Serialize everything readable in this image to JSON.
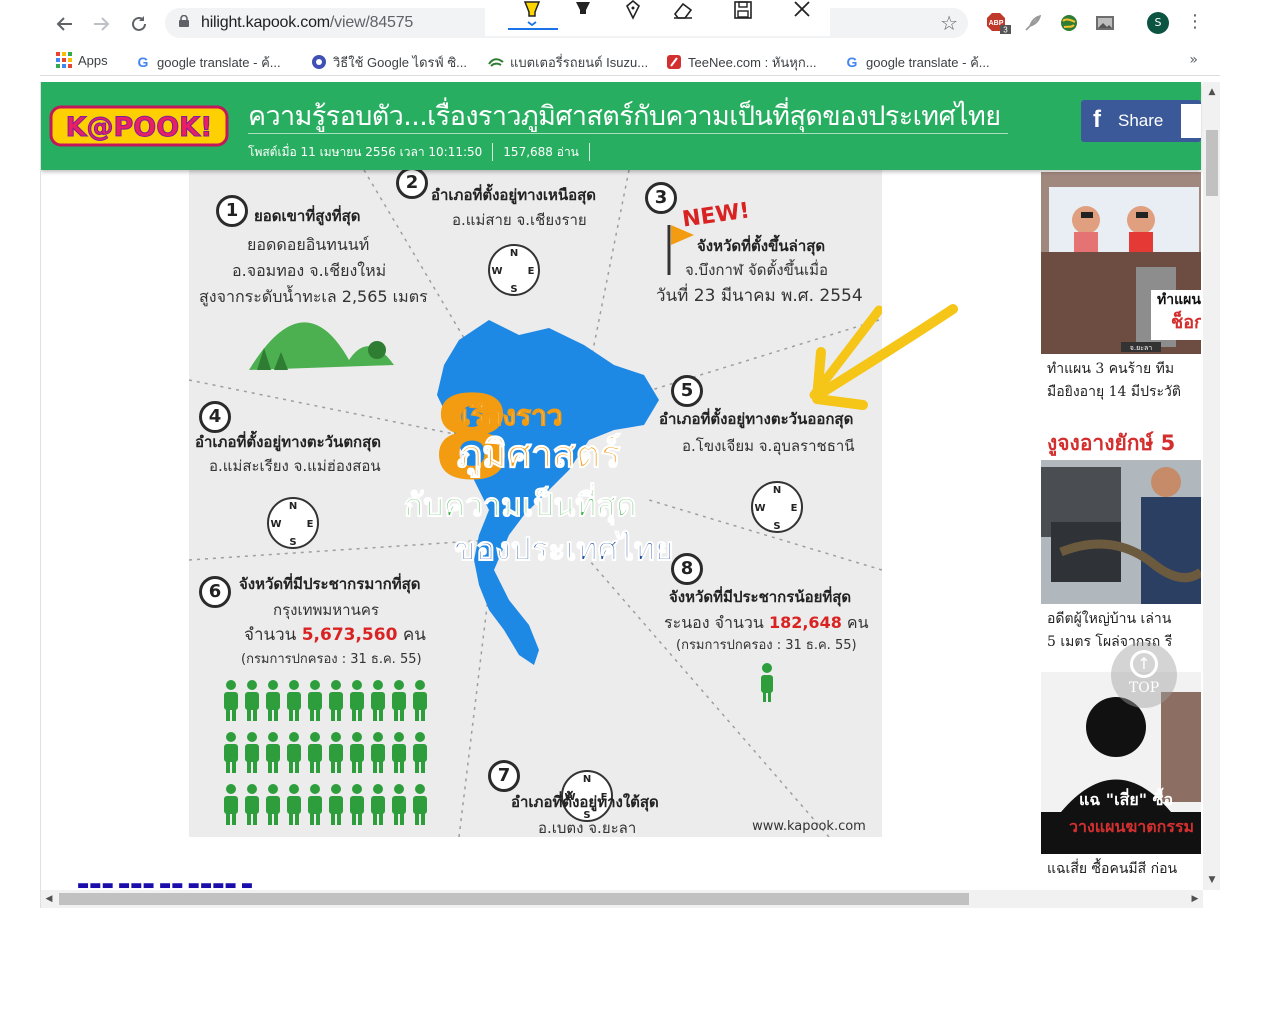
{
  "browser": {
    "url_host": "hilight.kapook.com",
    "url_path": "/view/84575",
    "profile_initial": "S",
    "abp_count": "3",
    "more_chevron": "»",
    "bookmarks": [
      {
        "label": "Apps",
        "icon": "apps-grid-icon"
      },
      {
        "label": "google translate - ค้...",
        "icon": "google-icon"
      },
      {
        "label": "วิธีใช้ Google ไดรฟ์ ซิ...",
        "icon": "drive-help-icon"
      },
      {
        "label": "แบตเตอรี่รถยนต์ Isuzu...",
        "icon": "battery-icon"
      },
      {
        "label": "TeeNee.com : หันหุก...",
        "icon": "teenee-icon"
      },
      {
        "label": "google translate - ค้...",
        "icon": "google-icon"
      }
    ]
  },
  "header": {
    "logo_text": "K@POOK!",
    "title": "ความรู้รอบตัว...เรื่องราวภูมิศาสตร์กับความเป็นที่สุดของประเทศไทย",
    "posted": "โพสต์เมื่อ 11 เมษายน 2556 เวลา 10:11:50",
    "views": "157,688 อ่าน",
    "share_label": "Share"
  },
  "infographic": {
    "center_number": "8",
    "center_line1": "เรื่องราว",
    "center_line2": "ภูมิศาสตร์",
    "center_line3": "กับความเป็นที่สุด",
    "center_line4": "ของประเทศไทย",
    "new_badge": "NEW!",
    "watermark": "www.kapook.com",
    "items": [
      {
        "n": "1",
        "title": "ยอดเขาที่สูงที่สุด",
        "lines": [
          "ยอดดอยอินทนนท์",
          "อ.จอมทอง จ.เชียงใหม่",
          "สูงจากระดับน้ำทะเล 2,565 เมตร"
        ]
      },
      {
        "n": "2",
        "title": "อำเภอที่ตั้งอยู่ทางเหนือสุด",
        "lines": [
          "อ.แม่สาย จ.เชียงราย"
        ]
      },
      {
        "n": "3",
        "title": "จังหวัดที่ตั้งขึ้นล่าสุด",
        "lines": [
          "จ.บึงกาฬ จัดตั้งขึ้นเมื่อ",
          "วันที่ 23 มีนาคม พ.ศ. 2554"
        ]
      },
      {
        "n": "4",
        "title": "อำเภอที่ตั้งอยู่ทางตะวันตกสุด",
        "lines": [
          "อ.แม่สะเรียง จ.แม่ฮ่องสอน"
        ]
      },
      {
        "n": "5",
        "title": "อำเภอที่ตั้งอยู่ทางตะวันออกสุด",
        "lines": [
          "อ.โขงเจียม จ.อุบลราชธานี"
        ]
      },
      {
        "n": "6",
        "title": "จังหวัดที่มีประชากรมากที่สุด",
        "lines": [
          "กรุงเทพมหานคร"
        ],
        "count_prefix": "จำนวน",
        "count": "5,673,560",
        "count_unit": "คน",
        "source": "(กรมการปกครอง : 31 ธ.ค. 55)"
      },
      {
        "n": "7",
        "title": "อำเภอที่ตั้งอยู่ทางใต้สุด",
        "lines": [
          "อ.เบตง จ.ยะลา"
        ]
      },
      {
        "n": "8",
        "title": "จังหวัดที่มีประชากรน้อยที่สุด",
        "lines": [],
        "count_prefix": "ระนอง จำนวน",
        "count": "182,648",
        "count_unit": "คน",
        "source": "(กรมการปกครอง : 31 ธ.ค. 55)"
      }
    ],
    "compass": {
      "n": "N",
      "s": "S",
      "e": "E",
      "w": "W"
    }
  },
  "sidebar": {
    "cards": [
      {
        "caption1": "ทำแผน 3 คนร้าย ทีม",
        "caption2": "มือยิงอายุ 14 มีประวัติ",
        "overlay": "ทำแผน",
        "overlay2": "ช็อก",
        "tag": "จ.ยะลา"
      },
      {
        "caption1": "อดีตผู้ใหญ่บ้าน เล่าน",
        "caption2": "5 เมตร โผล่จากรถ รี",
        "overlay": "งูจงอางยักษ์ 5"
      },
      {
        "caption1": "แฉเสี่ย ซื้อคนมีสี ก่อน",
        "caption2": "",
        "overlay": "แฉ \"เสี่ย\" ซื้อ",
        "overlay2": "วางแผนฆาตกรรม"
      }
    ]
  },
  "ui": {
    "top_label": "TOP"
  },
  "colors": {
    "header_green": "#27ae60",
    "facebook_blue": "#3b5998",
    "accent_red": "#d92323",
    "people_green": "#2e9e3c",
    "map_blue": "#1e88e5",
    "arrow_yellow": "#f5c518"
  }
}
